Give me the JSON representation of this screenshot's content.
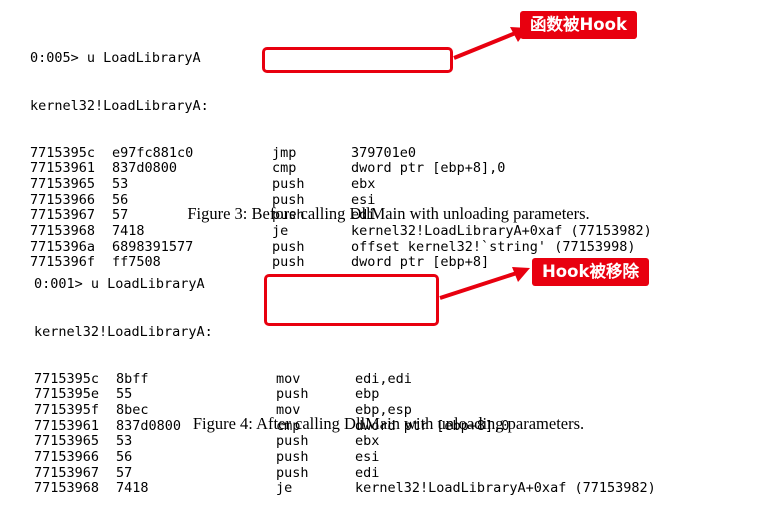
{
  "figure3": {
    "header": [
      "0:005> u LoadLibraryA",
      "kernel32!LoadLibraryA:"
    ],
    "rows": [
      {
        "addr": "7715395c",
        "bytes": "e97fc881c0",
        "op": "jmp",
        "args": "379701e0"
      },
      {
        "addr": "77153961",
        "bytes": "837d0800",
        "op": "cmp",
        "args": "dword ptr [ebp+8],0"
      },
      {
        "addr": "77153965",
        "bytes": "53",
        "op": "push",
        "args": "ebx"
      },
      {
        "addr": "77153966",
        "bytes": "56",
        "op": "push",
        "args": "esi"
      },
      {
        "addr": "77153967",
        "bytes": "57",
        "op": "push",
        "args": "edi"
      },
      {
        "addr": "77153968",
        "bytes": "7418",
        "op": "je",
        "args": "kernel32!LoadLibraryA+0xaf (77153982)"
      },
      {
        "addr": "7715396a",
        "bytes": "6898391577",
        "op": "push",
        "args": "offset kernel32!`string' (77153998)"
      },
      {
        "addr": "7715396f",
        "bytes": "ff7508",
        "op": "push",
        "args": "dword ptr [ebp+8]"
      }
    ],
    "caption": "Figure 3: Before calling DllMain with unloading parameters.",
    "annotation": "函数被Hook",
    "accent_color": "#e8000f"
  },
  "figure4": {
    "header": [
      "0:001> u LoadLibraryA",
      "kernel32!LoadLibraryA:"
    ],
    "rows": [
      {
        "addr": "7715395c",
        "bytes": "8bff",
        "op": "mov",
        "args": "edi,edi"
      },
      {
        "addr": "7715395e",
        "bytes": "55",
        "op": "push",
        "args": "ebp"
      },
      {
        "addr": "7715395f",
        "bytes": "8bec",
        "op": "mov",
        "args": "ebp,esp"
      },
      {
        "addr": "77153961",
        "bytes": "837d0800",
        "op": "cmp",
        "args": "dword ptr [ebp+8],0"
      },
      {
        "addr": "77153965",
        "bytes": "53",
        "op": "push",
        "args": "ebx"
      },
      {
        "addr": "77153966",
        "bytes": "56",
        "op": "push",
        "args": "esi"
      },
      {
        "addr": "77153967",
        "bytes": "57",
        "op": "push",
        "args": "edi"
      },
      {
        "addr": "77153968",
        "bytes": "7418",
        "op": "je",
        "args": "kernel32!LoadLibraryA+0xaf (77153982)"
      }
    ],
    "caption": "Figure 4: After calling DllMain with unloading parameters.",
    "annotation": "Hook被移除",
    "accent_color": "#e8000f"
  }
}
